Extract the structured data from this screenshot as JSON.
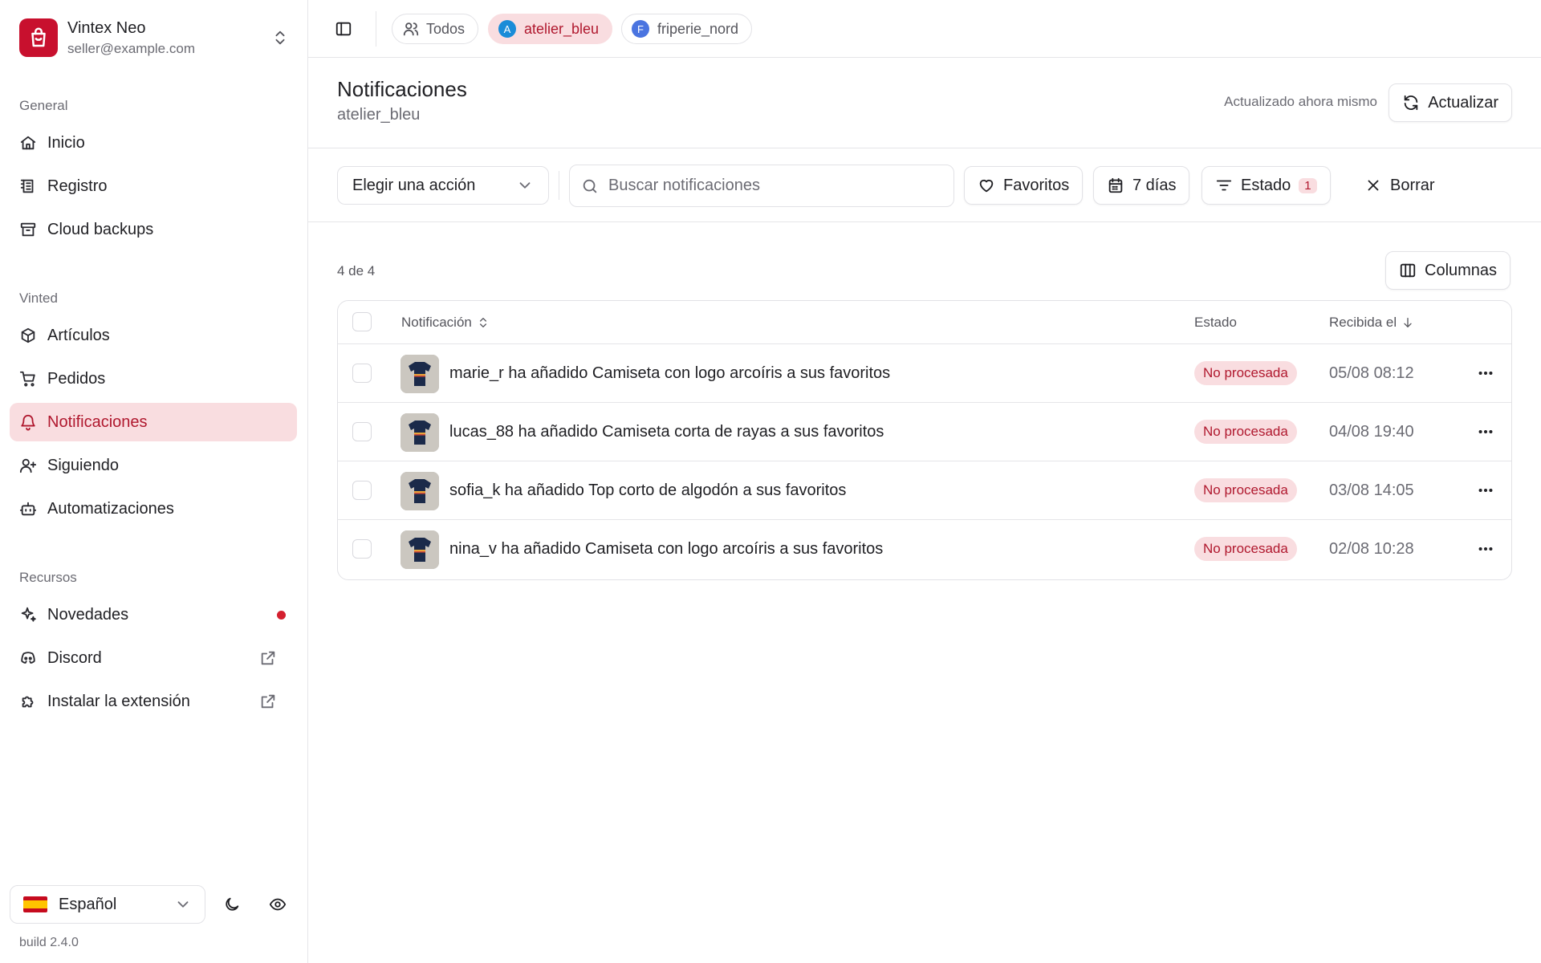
{
  "account": {
    "name": "Vintex Neo",
    "email": "seller@example.com"
  },
  "sidebar": {
    "sections": {
      "general": "General",
      "vinted": "Vinted",
      "resources": "Recursos"
    },
    "general_items": [
      {
        "label": "Inicio",
        "icon": "home-icon"
      },
      {
        "label": "Registro",
        "icon": "log-icon"
      },
      {
        "label": "Cloud backups",
        "icon": "archive-icon"
      }
    ],
    "vinted_items": [
      {
        "label": "Artículos",
        "icon": "package-icon"
      },
      {
        "label": "Pedidos",
        "icon": "cart-icon"
      },
      {
        "label": "Notificaciones",
        "icon": "bell-icon",
        "active": true
      },
      {
        "label": "Siguiendo",
        "icon": "user-plus-icon"
      },
      {
        "label": "Automatizaciones",
        "icon": "bot-icon"
      }
    ],
    "resource_items": [
      {
        "label": "Novedades",
        "icon": "sparkles-icon",
        "has_dot": true
      },
      {
        "label": "Discord",
        "icon": "discord-icon",
        "external": true
      },
      {
        "label": "Instalar la extensión",
        "icon": "puzzle-icon",
        "external": true
      }
    ],
    "language": "Español",
    "build": "build 2.4.0"
  },
  "topbar": {
    "chips": [
      {
        "label": "Todos",
        "icon": "users-icon"
      },
      {
        "label": "atelier_bleu",
        "avatar": "A",
        "avatar_color": "#1a8cd8",
        "active": true
      },
      {
        "label": "friperie_nord",
        "avatar": "F",
        "avatar_color": "#4a74e0"
      }
    ]
  },
  "header": {
    "title": "Notificaciones",
    "subtitle": "atelier_bleu",
    "updated": "Actualizado ahora mismo",
    "refresh_label": "Actualizar"
  },
  "toolbar": {
    "action_select": "Elegir una acción",
    "search_placeholder": "Buscar notificaciones",
    "favorites_label": "Favoritos",
    "days_label": "7 días",
    "status_label": "Estado",
    "status_count": "1",
    "clear_label": "Borrar"
  },
  "content": {
    "count": "4 de 4",
    "columns_label": "Columnas",
    "headers": {
      "notification": "Notificación",
      "status": "Estado",
      "received": "Recibida el"
    },
    "rows": [
      {
        "text": "marie_r ha añadido Camiseta con logo arcoíris a sus favoritos",
        "status": "No procesada",
        "date": "05/08 08:12"
      },
      {
        "text": "lucas_88 ha añadido Camiseta corta de rayas a sus favoritos",
        "status": "No procesada",
        "date": "04/08 19:40"
      },
      {
        "text": "sofia_k ha añadido Top corto de algodón a sus favoritos",
        "status": "No procesada",
        "date": "03/08 14:05"
      },
      {
        "text": "nina_v ha añadido Camiseta con logo arcoíris a sus favoritos",
        "status": "No procesada",
        "date": "02/08 10:28"
      }
    ]
  },
  "colors": {
    "accent": "#b0182e",
    "accent_bg": "#f9dde0",
    "brand": "#c8102e"
  }
}
